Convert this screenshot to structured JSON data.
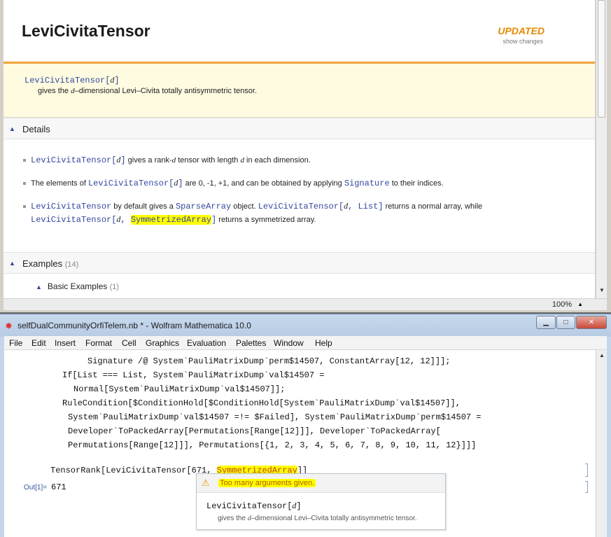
{
  "doc": {
    "title": "LeviCivitaTensor",
    "updated_label": "UPDATED",
    "show_changes": "show changes",
    "usage": {
      "func": "LeviCivitaTensor",
      "open": "[",
      "arg": "d",
      "close": "]",
      "desc_pre": "gives the ",
      "desc_arg": "d",
      "desc_post": "–dimensional Levi–Civita totally antisymmetric tensor."
    },
    "details": {
      "label": "Details",
      "bullets": [
        {
          "code": "LeviCivitaTensor[",
          "arg": "d",
          "code_close": "]",
          "text1": " gives a rank-",
          "it1": "d",
          "text2": " tensor with length ",
          "it2": "d",
          "text3": " in each dimension."
        },
        {
          "text1": "The elements of ",
          "code": "LeviCivitaTensor[",
          "arg": "d",
          "code_close": "]",
          "text2": " are ",
          "vals": "0, -1, +1",
          "text3": ", and can be obtained by applying ",
          "code2": "Signature",
          "text4": " to their indices."
        },
        {
          "code": "LeviCivitaTensor",
          "text1": " by default gives a ",
          "code2": "SparseArray",
          "text2": " object. ",
          "code3": "LeviCivitaTensor[",
          "arg": "d",
          "code3b": ", List]",
          "text3": " returns a normal array, while",
          "line2_code": "LeviCivitaTensor[",
          "line2_arg": "d",
          "line2_comma": ", ",
          "line2_hl": "SymmetrizedArray",
          "line2_close": "]",
          "line2_text": " returns a symmetrized array."
        }
      ]
    },
    "examples": {
      "label": "Examples",
      "count": "(14)"
    },
    "basic_examples": {
      "label": "Basic Examples",
      "count": "(1)"
    },
    "zoom": "100%"
  },
  "notebook": {
    "window_title": "selfDualCommunityOrfiTelem.nb * - Wolfram Mathematica 10.0",
    "menu": [
      "File",
      "Edit",
      "Insert",
      "Format",
      "Cell",
      "Graphics",
      "Evaluation",
      "Palettes",
      "Window",
      "Help"
    ],
    "code_lines": [
      "Signature /@ System`PauliMatrixDump`perm$14507, ConstantArray[12, 12]]];",
      "If[List === List, System`PauliMatrixDump`val$14507 =",
      "Normal[System`PauliMatrixDump`val$14507]];",
      "RuleCondition[$ConditionHold[$ConditionHold[System`PauliMatrixDump`val$14507]],",
      "System`PauliMatrixDump`val$14507 =!= $Failed], System`PauliMatrixDump`perm$14507 =",
      "Developer`ToPackedArray[Permutations[Range[12]]], Developer`ToPackedArray[",
      "Permutations[Range[12]]], Permutations[{1, 2, 3, 4, 5, 6, 7, 8, 9, 10, 11, 12}]]]"
    ],
    "input_pre": "TensorRank[LeviCivitaTensor[671, ",
    "input_hl": "SymmetrizedArray",
    "input_post": "]]",
    "out_label": "Out[1]=",
    "out_value": "671",
    "tooltip": {
      "message": "Too many arguments given.",
      "usage_func": "LeviCivitaTensor[",
      "usage_arg": "d",
      "usage_close": "]",
      "desc_pre": "gives the ",
      "desc_arg": "d",
      "desc_post": "–dimensional Levi–Civita totally antisymmetric tensor."
    }
  }
}
